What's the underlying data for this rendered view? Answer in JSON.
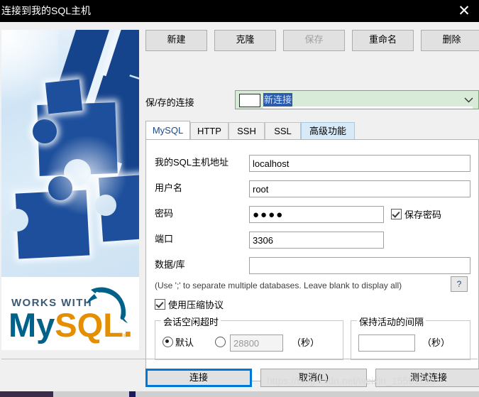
{
  "window": {
    "title": "连接到我的SQL主机",
    "close_label": "✕"
  },
  "toolbar": {
    "new_label": "新建",
    "clone_label": "克隆",
    "save_label": "保存",
    "rename_label": "重命名",
    "delete_label": "删除"
  },
  "saved_connection": {
    "label": "保/存的连接",
    "value": "新连接",
    "chevron": "chevron-down-icon"
  },
  "tabs": [
    {
      "label": "MySQL",
      "state": "active"
    },
    {
      "label": "HTTP",
      "state": "normal"
    },
    {
      "label": "SSH",
      "state": "normal"
    },
    {
      "label": "SSL",
      "state": "normal"
    },
    {
      "label": "高级功能",
      "state": "hover"
    }
  ],
  "form": {
    "host_label": "我的SQL主机地址",
    "host_value": "localhost",
    "user_label": "用户名",
    "user_value": "root",
    "password_label": "密码",
    "password_value": "●●●●",
    "save_password_label": "保存密码",
    "save_password_checked": true,
    "port_label": "端口",
    "port_value": "3306",
    "database_label": "数据/库",
    "database_value": "",
    "database_hint": "(Use ';' to separate multiple databases. Leave blank to display all)",
    "help_label": "?",
    "compress_label": "使用压缩协议",
    "compress_checked": true
  },
  "idle_timeout": {
    "title": "会话空闲超时",
    "default_label": "默认",
    "default_selected": true,
    "custom_selected": false,
    "custom_value": "28800",
    "unit": "（秒）"
  },
  "keepalive": {
    "title": "保持活动的间隔",
    "value": "",
    "unit": "（秒）"
  },
  "footer": {
    "connect_label": "连接",
    "cancel_label": "取消(L)",
    "test_label": "测试连接"
  },
  "banner": {
    "works_with": "WORKS WITH",
    "mysql_my": "My",
    "mysql_sql": "SQL",
    "mysql_dot": ".",
    "trademark": "®"
  },
  "watermark": {
    "text": "https://blog.csdn.net/weixin_15591180"
  }
}
